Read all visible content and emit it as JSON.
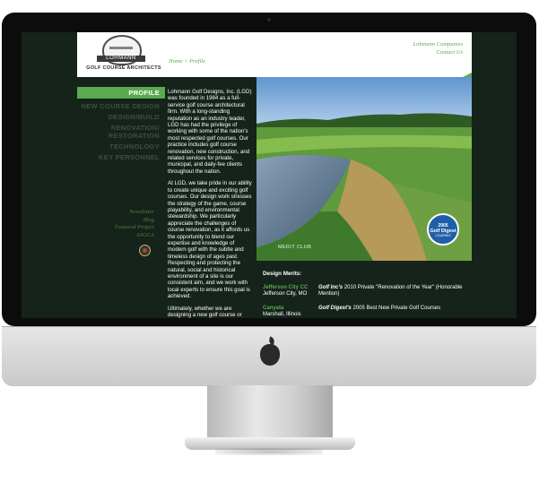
{
  "site": {
    "logo": {
      "banner": "LOHMANN",
      "subtitle": "GOLF COURSE ARCHITECTS"
    },
    "breadcrumb": "Home > Profile",
    "top_links": [
      "Lohmann Companies",
      "Contact Us"
    ]
  },
  "nav": {
    "items": [
      {
        "label": "PROFILE",
        "active": true
      },
      {
        "label": "NEW COURSE DESIGN",
        "active": false
      },
      {
        "label": "DESIGN/BUILD",
        "active": false
      },
      {
        "label": "RENOVATION/ RESTORATION",
        "active": false
      },
      {
        "label": "TECHNOLOGY",
        "active": false
      },
      {
        "label": "KEY PERSONNEL",
        "active": false
      }
    ],
    "sub_links": [
      "Newsletter",
      "Blog",
      "Featured Project",
      "ASGCA"
    ]
  },
  "body": {
    "paragraphs": [
      "Lohmann Golf Designs, Inc. (LGD) was founded in 1984 as a full-service golf course architectural firm. With a long-standing reputation as an industry leader, LGD has had the privilege of working with some of the nation's most respected golf courses. Our practice includes golf course renovation, new construction, and related services for private, municipal, and daily-fee clients throughout the nation.",
      "At LGD, we take pride in our ability to create unique and exciting golf courses. Our design work stresses the strategy of the game, course playability, and environmental stewardship. We particularly appreciate the challenges of course renovation, as it affords us the opportunity to blend our expertise and knowledge of modern golf with the subtle and timeless design of ages past. Respecting and protecting the natural, social and historical environment of a site is our consistent aim, and we work with local experts to ensure this goal is achieved.",
      "Ultimately, whether we are designing a new golf course or remodeling an existing layout, we enjoy what we do and hope people look forward to playing our courses."
    ]
  },
  "hero": {
    "caption": "MERIT CLUB",
    "badge": {
      "year": "2005",
      "title": "Golf Digest",
      "sub": "COURSES"
    }
  },
  "merits": {
    "title": "Design Merits:",
    "items": [
      {
        "club": "Jefferson City CC",
        "location": "Jefferson City, MO",
        "magazine": "Golf Inc's",
        "award": "2010 Private \"Renovation of the Year\" (Honorable Mention)"
      },
      {
        "club": "Canyata",
        "location": "Marshall, Illinois",
        "magazine": "Golf Digest's",
        "award": "2005 Best New Private Golf Courses"
      }
    ]
  },
  "colors": {
    "accent_green": "#5aaa4e",
    "page_dark": "#15231a",
    "nav_inactive": "#3e4f40"
  }
}
